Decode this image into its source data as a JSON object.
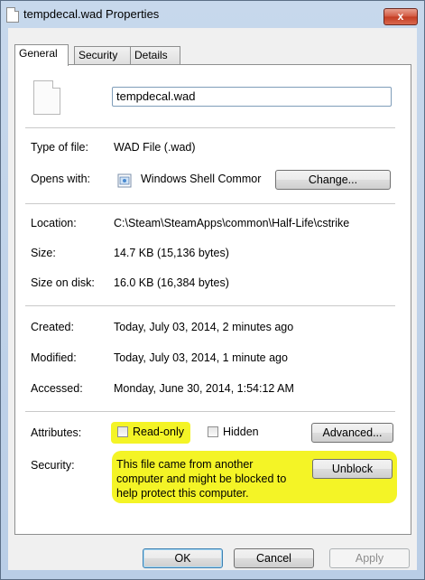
{
  "window": {
    "title": "tempdecal.wad Properties",
    "close_symbol": "x"
  },
  "tabs": [
    {
      "label": "General",
      "active": true
    },
    {
      "label": "Security",
      "active": false
    },
    {
      "label": "Details",
      "active": false
    }
  ],
  "file": {
    "name": "tempdecal.wad",
    "icon": "file-icon"
  },
  "info": {
    "type_label": "Type of file:",
    "type_value": "WAD File (.wad)",
    "opens_label": "Opens with:",
    "opens_value": "Windows Shell Commor",
    "opens_icon": "windows-shell-icon",
    "change_button": "Change...",
    "location_label": "Location:",
    "location_value": "C:\\Steam\\SteamApps\\common\\Half-Life\\cstrike",
    "size_label": "Size:",
    "size_value": "14.7 KB (15,136 bytes)",
    "size_on_disk_label": "Size on disk:",
    "size_on_disk_value": "16.0 KB (16,384 bytes)",
    "created_label": "Created:",
    "created_value": "Today, July 03, 2014, 2 minutes ago",
    "modified_label": "Modified:",
    "modified_value": "Today, July 03, 2014, 1 minute ago",
    "accessed_label": "Accessed:",
    "accessed_value": "Monday, June 30, 2014, 1:54:12 AM"
  },
  "attributes": {
    "label": "Attributes:",
    "read_only_label": "Read-only",
    "read_only_checked": false,
    "hidden_label": "Hidden",
    "hidden_checked": false,
    "advanced_button": "Advanced..."
  },
  "security": {
    "label": "Security:",
    "line1": "This file came from another",
    "line2": "computer and might be blocked to",
    "line3": "help protect this computer.",
    "unblock_button": "Unblock",
    "highlight_color": "#f2f200"
  },
  "footer": {
    "ok_button": "OK",
    "cancel_button": "Cancel",
    "apply_button": "Apply"
  }
}
